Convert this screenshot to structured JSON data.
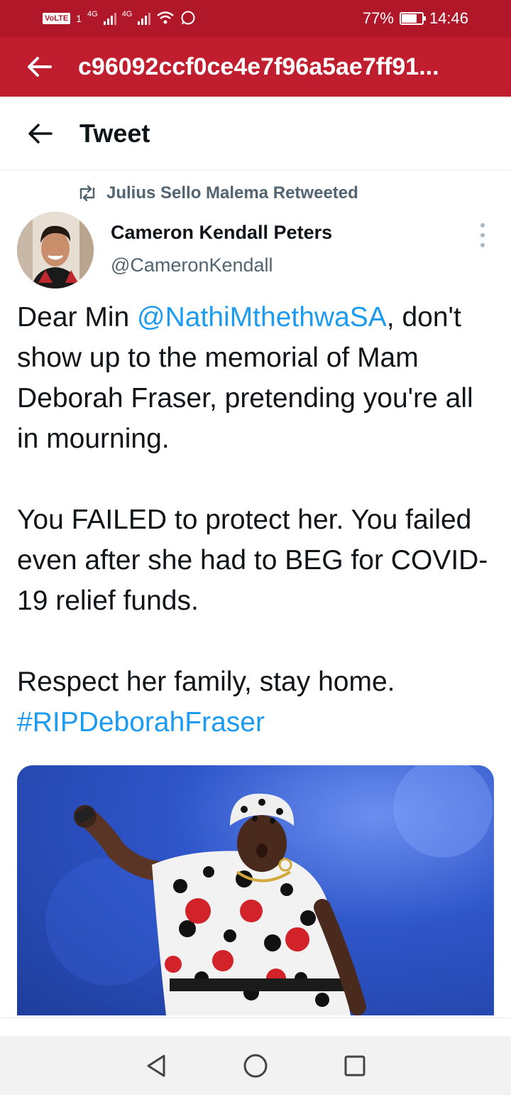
{
  "status_bar": {
    "volte": "VoLTE",
    "sim1": "1",
    "net1": "4G",
    "net2": "4G",
    "battery_percent": "77%",
    "battery_level": 0.77,
    "time": "14:46"
  },
  "app_bar": {
    "title": "c96092ccf0ce4e7f96a5ae7ff91..."
  },
  "header": {
    "title": "Tweet"
  },
  "retweet": {
    "label": "Julius Sello Malema Retweeted"
  },
  "author": {
    "name": "Cameron Kendall Peters",
    "handle": "@CameronKendall"
  },
  "tweet": {
    "p1_prefix": "Dear Min ",
    "p1_mention": "@NathiMthethwaSA",
    "p1_suffix": ", don't show up to the memorial of Mam Deborah Fraser, pretending you're all in mourning.",
    "p2": "You FAILED to protect her. You failed even after she had to BEG for COVID-19 relief funds.",
    "p3": "Respect her family, stay home.",
    "hashtag": "#RIPDeborahFraser"
  },
  "icons": {
    "back": "arrow-left-icon",
    "retweet": "retweet-icon",
    "more": "more-vertical-icon",
    "nav_back": "triangle-back-icon",
    "nav_home": "circle-home-icon",
    "nav_recents": "square-recents-icon"
  },
  "colors": {
    "status_bar": "#b0182a",
    "app_bar": "#c01d2e",
    "link": "#1d9bf0",
    "text": "#0f1419",
    "muted": "#536471"
  }
}
